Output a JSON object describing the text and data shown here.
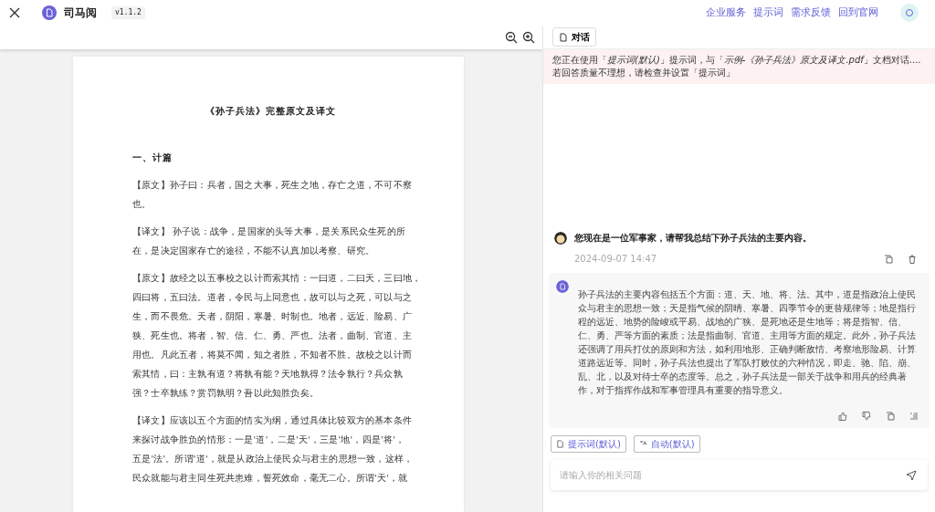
{
  "header": {
    "app_name": "司马阅",
    "version": "v1.1.2",
    "links": [
      "企业服务",
      "提示词",
      "需求反馈",
      "回到官网"
    ]
  },
  "document": {
    "title": "《孙子兵法》完整原文及译文",
    "heading": "一、计篇",
    "paragraphs": [
      {
        "lines": [
          "【原文】孙子曰：兵者，国之大事，死生之地，存亡之道，不可不察",
          "也。"
        ]
      },
      {
        "lines": [
          "【译文】 孙子说：战争，是国家的头等大事，是关系民众生死的所",
          "在，是决定国家存亡的途径，不能不认真加以考察、研究。"
        ]
      },
      {
        "lines": [
          "【原文】故经之以五事校之以计而索其情：一曰道，二曰天，三曰地，",
          "四曰将，五曰法。道者，令民与上同意也，故可以与之死，可以与之",
          "生，而不畏危。天者，阴阳，寒暑、时制也。地者，远近、险易、广",
          "狭、死生也。将者，智、信、仁、勇、严也。法者，曲制、官道、主",
          "用也。凡此五者，将莫不闻，知之者胜，不知者不胜。故校之以计而",
          "索其情，曰：主孰有道？将孰有能？天地孰得？法令孰行？兵众孰",
          "强？士卒孰练？赏罚孰明？吾以此知胜负矣。"
        ]
      },
      {
        "lines": [
          "【译文】应该以五个方面的情实为纲，通过具体比较双方的基本条件",
          "来探讨战争胜负的情形：一是'道'，二是'天'，三是'地'，四是'将'，",
          "五是'法'。所谓'道'，就是从政治上使民众与君主的思想一致，这样，",
          "民众就能与君主同生死共患难，誓死效命，毫无二心。所谓'天'，就"
        ]
      }
    ]
  },
  "chat": {
    "tab": {
      "label": "对话",
      "selected": true
    },
    "notice": [
      "您正在使用「*提示词(默认)*」提示词，与「*示例-《孙子兵法》原文及译文.pdf*」文档对话....",
      "若回答质量不理想，请检查并设置「提示词」"
    ],
    "messages": [
      {
        "kind": "user",
        "text": "您现在是一位军事家，请帮我总结下孙子兵法的主要内容。",
        "time": "2024-09-07 14:47"
      },
      {
        "kind": "assistant",
        "text": "孙子兵法的主要内容包括五个方面：道、天、地、将、法。其中，道是指政治上使民众与君主的思想一致；天是指气候的阴晴、寒暑、四季节令的更替规律等；地是指行程的远近、地势的险峻或平易、战地的广狭、是死地还是生地等；将是指智、信、仁、勇、严等方面的素质；法是指曲制、官道、主用等方面的规定。此外，孙子兵法还强调了用兵打仗的原则和方法，如利用地形、正确判断敌情、考察地形险易、计算道路远近等。同时，孙子兵法也提出了军队打败仗的六种情况，即走、驰、陷、崩、乱、北，以及对待士卒的态度等。总之，孙子兵法是一部关于战争和用兵的经典著作，对于指挥作战和军事管理具有重要的指导意义。"
      }
    ],
    "chips": [
      {
        "kind": "prompt",
        "label": "提示词(默认)"
      },
      {
        "kind": "mode",
        "label": "自动(默认)"
      }
    ],
    "input": {
      "placeholder": "请输入你的相关问题"
    }
  }
}
